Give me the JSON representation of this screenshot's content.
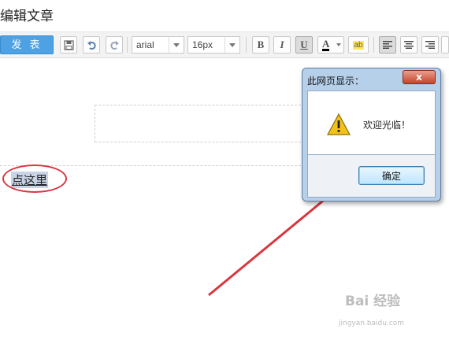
{
  "page": {
    "title": "编辑文章"
  },
  "toolbar": {
    "publish_label": "发 表",
    "font_family": "arial",
    "font_size": "16px",
    "bold_label": "B",
    "italic_label": "I",
    "underline_label": "U",
    "font_color_label": "A",
    "highlight_label": "ab"
  },
  "editor": {
    "link_text": "点这里"
  },
  "dialog": {
    "title": "此网页显示：",
    "close_label": "x",
    "message": "欢迎光临！",
    "ok_label": "确定"
  },
  "watermark": {
    "brand": "Bai 经验",
    "url": "jingyan.baidu.com"
  },
  "colors": {
    "publish_button": "#4ea1e3",
    "annotation_red": "#d9363e",
    "dialog_frame": "#b7d0ea"
  },
  "icons": [
    "save-icon",
    "undo-icon",
    "redo-icon",
    "warning-icon",
    "chevron-down-icon",
    "align-left-icon",
    "align-center-icon",
    "align-right-icon"
  ]
}
